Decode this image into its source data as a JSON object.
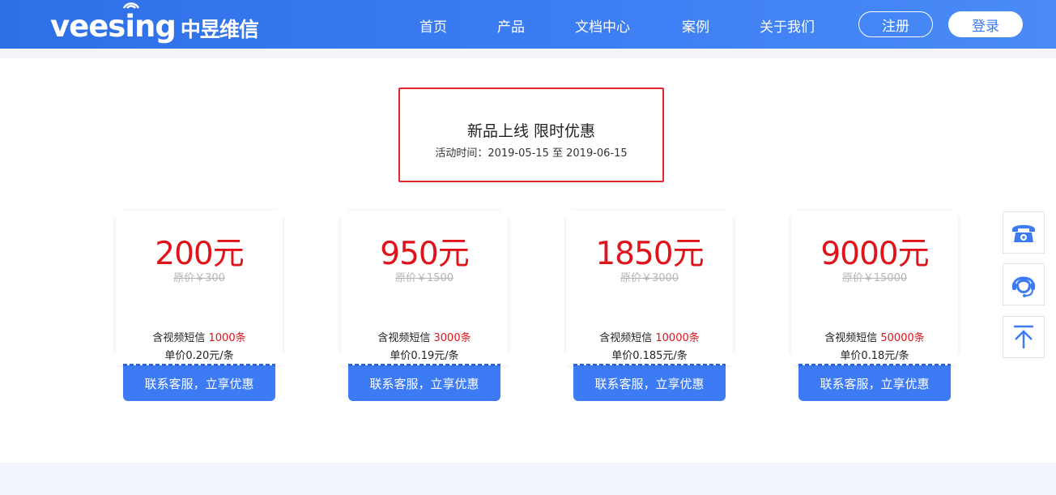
{
  "header": {
    "logo_en": "veesing",
    "logo_cn": "中昱维信",
    "nav": [
      "首页",
      "产品",
      "文档中心",
      "案例",
      "关于我们"
    ],
    "register_label": "注册",
    "login_label": "登录"
  },
  "promo": {
    "title": "新品上线 限时优惠",
    "time": "活动时间：2019-05-15 至 2019-06-15"
  },
  "cards": [
    {
      "price": "200元",
      "original": "原价￥300",
      "contain_prefix": "含视频短信 ",
      "quantity": "1000条",
      "unit_price": "单价0.20元/条",
      "button": "联系客服，立享优惠"
    },
    {
      "price": "950元",
      "original": "原价￥1500",
      "contain_prefix": "含视频短信 ",
      "quantity": "3000条",
      "unit_price": "单价0.19元/条",
      "button": "联系客服，立享优惠"
    },
    {
      "price": "1850元",
      "original": "原价￥3000",
      "contain_prefix": "含视频短信 ",
      "quantity": "10000条",
      "unit_price": "单价0.185元/条",
      "button": "联系客服，立享优惠"
    },
    {
      "price": "9000元",
      "original": "原价￥15000",
      "contain_prefix": "含视频短信 ",
      "quantity": "50000条",
      "unit_price": "单价0.18元/条",
      "button": "联系客服，立享优惠"
    }
  ],
  "side_buttons": [
    "phone-icon",
    "customer-service-icon",
    "back-to-top-icon"
  ],
  "colors": {
    "header_blue": "#3b7cf3",
    "accent_red": "#e0131b",
    "button_blue": "#3d7bf5"
  }
}
